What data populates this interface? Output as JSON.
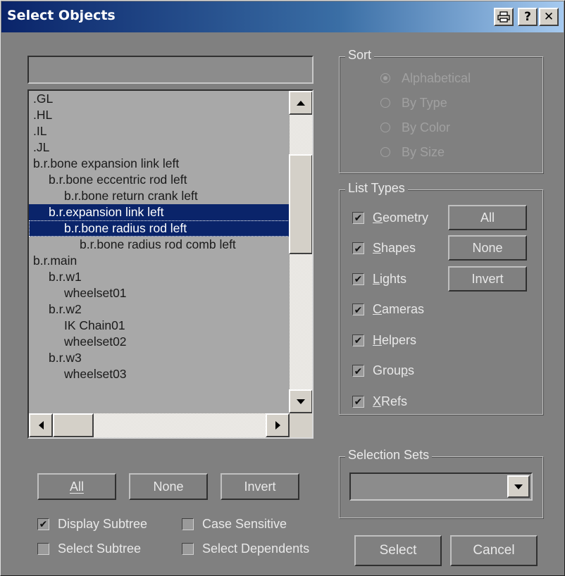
{
  "window": {
    "title": "Select Objects",
    "controls": {
      "print_icon": "printer-icon",
      "help_label": "?",
      "close_label": "✕"
    }
  },
  "search": {
    "value": ""
  },
  "list": {
    "items": [
      {
        "label": ".GL",
        "indent": 0,
        "selected": false
      },
      {
        "label": ".HL",
        "indent": 0,
        "selected": false
      },
      {
        "label": ".IL",
        "indent": 0,
        "selected": false
      },
      {
        "label": ".JL",
        "indent": 0,
        "selected": false
      },
      {
        "label": "b.r.bone expansion link left",
        "indent": 0,
        "selected": false
      },
      {
        "label": "b.r.bone eccentric rod left",
        "indent": 1,
        "selected": false
      },
      {
        "label": "b.r.bone return crank left",
        "indent": 2,
        "selected": false
      },
      {
        "label": "b.r.expansion link left",
        "indent": 1,
        "selected": true
      },
      {
        "label": "b.r.bone radius rod left",
        "indent": 2,
        "selected": true,
        "focused": true
      },
      {
        "label": "b.r.bone radius rod comb left",
        "indent": 3,
        "selected": false
      },
      {
        "label": "b.r.main",
        "indent": 0,
        "selected": false
      },
      {
        "label": "b.r.w1",
        "indent": 1,
        "selected": false
      },
      {
        "label": "wheelset01",
        "indent": 2,
        "selected": false
      },
      {
        "label": "b.r.w2",
        "indent": 1,
        "selected": false
      },
      {
        "label": "IK Chain01",
        "indent": 2,
        "selected": false
      },
      {
        "label": "wheelset02",
        "indent": 2,
        "selected": false
      },
      {
        "label": "b.r.w3",
        "indent": 1,
        "selected": false
      },
      {
        "label": "wheelset03",
        "indent": 2,
        "selected": false
      }
    ]
  },
  "selection_buttons": {
    "all": "All",
    "none": "None",
    "invert": "Invert"
  },
  "options": {
    "display_subtree": {
      "label": "Display Subtree",
      "checked": true
    },
    "case_sensitive": {
      "label": "Case Sensitive",
      "checked": false
    },
    "select_subtree": {
      "label": "Select Subtree",
      "checked": false
    },
    "select_dependents": {
      "label": "Select Dependents",
      "checked": false
    }
  },
  "sort": {
    "title": "Sort",
    "options": [
      {
        "label": "Alphabetical",
        "checked": true
      },
      {
        "label": "By Type",
        "checked": false
      },
      {
        "label": "By Color",
        "checked": false
      },
      {
        "label": "By Size",
        "checked": false
      }
    ]
  },
  "list_types": {
    "title": "List Types",
    "items": [
      {
        "label": "Geometry",
        "checked": true
      },
      {
        "label": "Shapes",
        "checked": true
      },
      {
        "label": "Lights",
        "checked": true
      },
      {
        "label": "Cameras",
        "checked": true
      },
      {
        "label": "Helpers",
        "checked": true
      },
      {
        "label": "Groups",
        "checked": true
      },
      {
        "label": "XRefs",
        "checked": true
      }
    ],
    "buttons": {
      "all": "All",
      "none": "None",
      "invert": "Invert"
    }
  },
  "selection_sets": {
    "title": "Selection Sets",
    "value": ""
  },
  "actions": {
    "select": "Select",
    "cancel": "Cancel"
  },
  "colors": {
    "dialog_bg": "#808080",
    "title_bar": "#0a246a",
    "selection": "#0a246a"
  }
}
